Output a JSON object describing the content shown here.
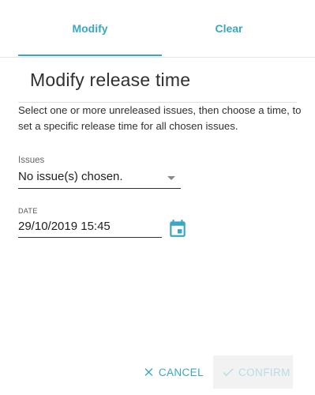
{
  "tabs": [
    {
      "label": "Modify",
      "active": true
    },
    {
      "label": "Clear",
      "active": false
    }
  ],
  "heading": "Modify release time",
  "description": "Select one or more unreleased issues, then choose a time, to set a specific release time for all chosen issues.",
  "issues": {
    "label": "Issues",
    "value": "No issue(s) chosen."
  },
  "date": {
    "label": "DATE",
    "value": "29/10/2019 15:45",
    "icon": "calendar-icon"
  },
  "actions": {
    "cancel_label": "CANCEL",
    "confirm_label": "CONFIRM",
    "confirm_disabled": true
  },
  "colors": {
    "accent": "#3aa7c2",
    "disabled_text": "#b8dce6",
    "disabled_bg": "#f2f2f2"
  }
}
